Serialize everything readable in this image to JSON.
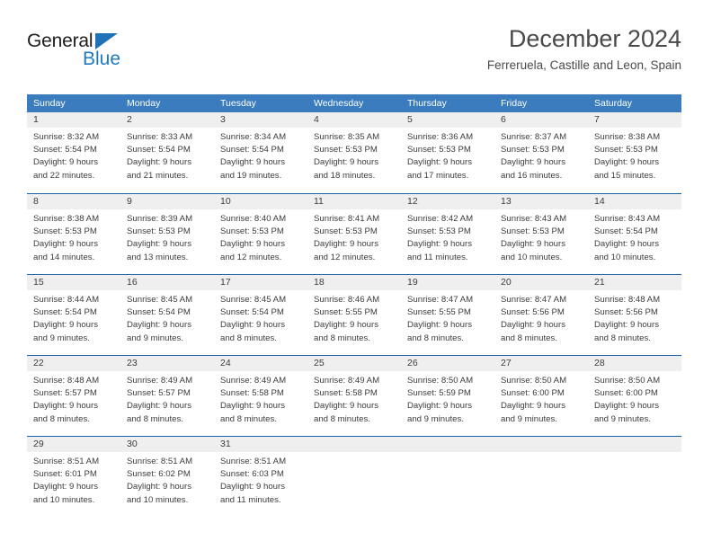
{
  "logo": {
    "word_one": "General",
    "word_two": "Blue",
    "triangle_color": "#1f72b8",
    "blue_color": "#1f7ac4"
  },
  "header": {
    "title": "December 2024",
    "subtitle": "Ferreruela, Castille and Leon, Spain"
  },
  "theme": {
    "header_blue": "#3a7cbe",
    "row_divider_blue": "#1f64a8",
    "day_number_strip": "#efefef",
    "text_color": "#3c3c3c"
  },
  "calendar": {
    "weekdays": [
      "Sunday",
      "Monday",
      "Tuesday",
      "Wednesday",
      "Thursday",
      "Friday",
      "Saturday"
    ],
    "weeks": [
      [
        {
          "day": "1",
          "sunrise": "Sunrise: 8:32 AM",
          "sunset": "Sunset: 5:54 PM",
          "daylight_1": "Daylight: 9 hours",
          "daylight_2": "and 22 minutes."
        },
        {
          "day": "2",
          "sunrise": "Sunrise: 8:33 AM",
          "sunset": "Sunset: 5:54 PM",
          "daylight_1": "Daylight: 9 hours",
          "daylight_2": "and 21 minutes."
        },
        {
          "day": "3",
          "sunrise": "Sunrise: 8:34 AM",
          "sunset": "Sunset: 5:54 PM",
          "daylight_1": "Daylight: 9 hours",
          "daylight_2": "and 19 minutes."
        },
        {
          "day": "4",
          "sunrise": "Sunrise: 8:35 AM",
          "sunset": "Sunset: 5:53 PM",
          "daylight_1": "Daylight: 9 hours",
          "daylight_2": "and 18 minutes."
        },
        {
          "day": "5",
          "sunrise": "Sunrise: 8:36 AM",
          "sunset": "Sunset: 5:53 PM",
          "daylight_1": "Daylight: 9 hours",
          "daylight_2": "and 17 minutes."
        },
        {
          "day": "6",
          "sunrise": "Sunrise: 8:37 AM",
          "sunset": "Sunset: 5:53 PM",
          "daylight_1": "Daylight: 9 hours",
          "daylight_2": "and 16 minutes."
        },
        {
          "day": "7",
          "sunrise": "Sunrise: 8:38 AM",
          "sunset": "Sunset: 5:53 PM",
          "daylight_1": "Daylight: 9 hours",
          "daylight_2": "and 15 minutes."
        }
      ],
      [
        {
          "day": "8",
          "sunrise": "Sunrise: 8:38 AM",
          "sunset": "Sunset: 5:53 PM",
          "daylight_1": "Daylight: 9 hours",
          "daylight_2": "and 14 minutes."
        },
        {
          "day": "9",
          "sunrise": "Sunrise: 8:39 AM",
          "sunset": "Sunset: 5:53 PM",
          "daylight_1": "Daylight: 9 hours",
          "daylight_2": "and 13 minutes."
        },
        {
          "day": "10",
          "sunrise": "Sunrise: 8:40 AM",
          "sunset": "Sunset: 5:53 PM",
          "daylight_1": "Daylight: 9 hours",
          "daylight_2": "and 12 minutes."
        },
        {
          "day": "11",
          "sunrise": "Sunrise: 8:41 AM",
          "sunset": "Sunset: 5:53 PM",
          "daylight_1": "Daylight: 9 hours",
          "daylight_2": "and 12 minutes."
        },
        {
          "day": "12",
          "sunrise": "Sunrise: 8:42 AM",
          "sunset": "Sunset: 5:53 PM",
          "daylight_1": "Daylight: 9 hours",
          "daylight_2": "and 11 minutes."
        },
        {
          "day": "13",
          "sunrise": "Sunrise: 8:43 AM",
          "sunset": "Sunset: 5:53 PM",
          "daylight_1": "Daylight: 9 hours",
          "daylight_2": "and 10 minutes."
        },
        {
          "day": "14",
          "sunrise": "Sunrise: 8:43 AM",
          "sunset": "Sunset: 5:54 PM",
          "daylight_1": "Daylight: 9 hours",
          "daylight_2": "and 10 minutes."
        }
      ],
      [
        {
          "day": "15",
          "sunrise": "Sunrise: 8:44 AM",
          "sunset": "Sunset: 5:54 PM",
          "daylight_1": "Daylight: 9 hours",
          "daylight_2": "and 9 minutes."
        },
        {
          "day": "16",
          "sunrise": "Sunrise: 8:45 AM",
          "sunset": "Sunset: 5:54 PM",
          "daylight_1": "Daylight: 9 hours",
          "daylight_2": "and 9 minutes."
        },
        {
          "day": "17",
          "sunrise": "Sunrise: 8:45 AM",
          "sunset": "Sunset: 5:54 PM",
          "daylight_1": "Daylight: 9 hours",
          "daylight_2": "and 8 minutes."
        },
        {
          "day": "18",
          "sunrise": "Sunrise: 8:46 AM",
          "sunset": "Sunset: 5:55 PM",
          "daylight_1": "Daylight: 9 hours",
          "daylight_2": "and 8 minutes."
        },
        {
          "day": "19",
          "sunrise": "Sunrise: 8:47 AM",
          "sunset": "Sunset: 5:55 PM",
          "daylight_1": "Daylight: 9 hours",
          "daylight_2": "and 8 minutes."
        },
        {
          "day": "20",
          "sunrise": "Sunrise: 8:47 AM",
          "sunset": "Sunset: 5:56 PM",
          "daylight_1": "Daylight: 9 hours",
          "daylight_2": "and 8 minutes."
        },
        {
          "day": "21",
          "sunrise": "Sunrise: 8:48 AM",
          "sunset": "Sunset: 5:56 PM",
          "daylight_1": "Daylight: 9 hours",
          "daylight_2": "and 8 minutes."
        }
      ],
      [
        {
          "day": "22",
          "sunrise": "Sunrise: 8:48 AM",
          "sunset": "Sunset: 5:57 PM",
          "daylight_1": "Daylight: 9 hours",
          "daylight_2": "and 8 minutes."
        },
        {
          "day": "23",
          "sunrise": "Sunrise: 8:49 AM",
          "sunset": "Sunset: 5:57 PM",
          "daylight_1": "Daylight: 9 hours",
          "daylight_2": "and 8 minutes."
        },
        {
          "day": "24",
          "sunrise": "Sunrise: 8:49 AM",
          "sunset": "Sunset: 5:58 PM",
          "daylight_1": "Daylight: 9 hours",
          "daylight_2": "and 8 minutes."
        },
        {
          "day": "25",
          "sunrise": "Sunrise: 8:49 AM",
          "sunset": "Sunset: 5:58 PM",
          "daylight_1": "Daylight: 9 hours",
          "daylight_2": "and 8 minutes."
        },
        {
          "day": "26",
          "sunrise": "Sunrise: 8:50 AM",
          "sunset": "Sunset: 5:59 PM",
          "daylight_1": "Daylight: 9 hours",
          "daylight_2": "and 9 minutes."
        },
        {
          "day": "27",
          "sunrise": "Sunrise: 8:50 AM",
          "sunset": "Sunset: 6:00 PM",
          "daylight_1": "Daylight: 9 hours",
          "daylight_2": "and 9 minutes."
        },
        {
          "day": "28",
          "sunrise": "Sunrise: 8:50 AM",
          "sunset": "Sunset: 6:00 PM",
          "daylight_1": "Daylight: 9 hours",
          "daylight_2": "and 9 minutes."
        }
      ],
      [
        {
          "day": "29",
          "sunrise": "Sunrise: 8:51 AM",
          "sunset": "Sunset: 6:01 PM",
          "daylight_1": "Daylight: 9 hours",
          "daylight_2": "and 10 minutes."
        },
        {
          "day": "30",
          "sunrise": "Sunrise: 8:51 AM",
          "sunset": "Sunset: 6:02 PM",
          "daylight_1": "Daylight: 9 hours",
          "daylight_2": "and 10 minutes."
        },
        {
          "day": "31",
          "sunrise": "Sunrise: 8:51 AM",
          "sunset": "Sunset: 6:03 PM",
          "daylight_1": "Daylight: 9 hours",
          "daylight_2": "and 11 minutes."
        },
        {
          "day": "",
          "sunrise": "",
          "sunset": "",
          "daylight_1": "",
          "daylight_2": ""
        },
        {
          "day": "",
          "sunrise": "",
          "sunset": "",
          "daylight_1": "",
          "daylight_2": ""
        },
        {
          "day": "",
          "sunrise": "",
          "sunset": "",
          "daylight_1": "",
          "daylight_2": ""
        },
        {
          "day": "",
          "sunrise": "",
          "sunset": "",
          "daylight_1": "",
          "daylight_2": ""
        }
      ]
    ]
  }
}
